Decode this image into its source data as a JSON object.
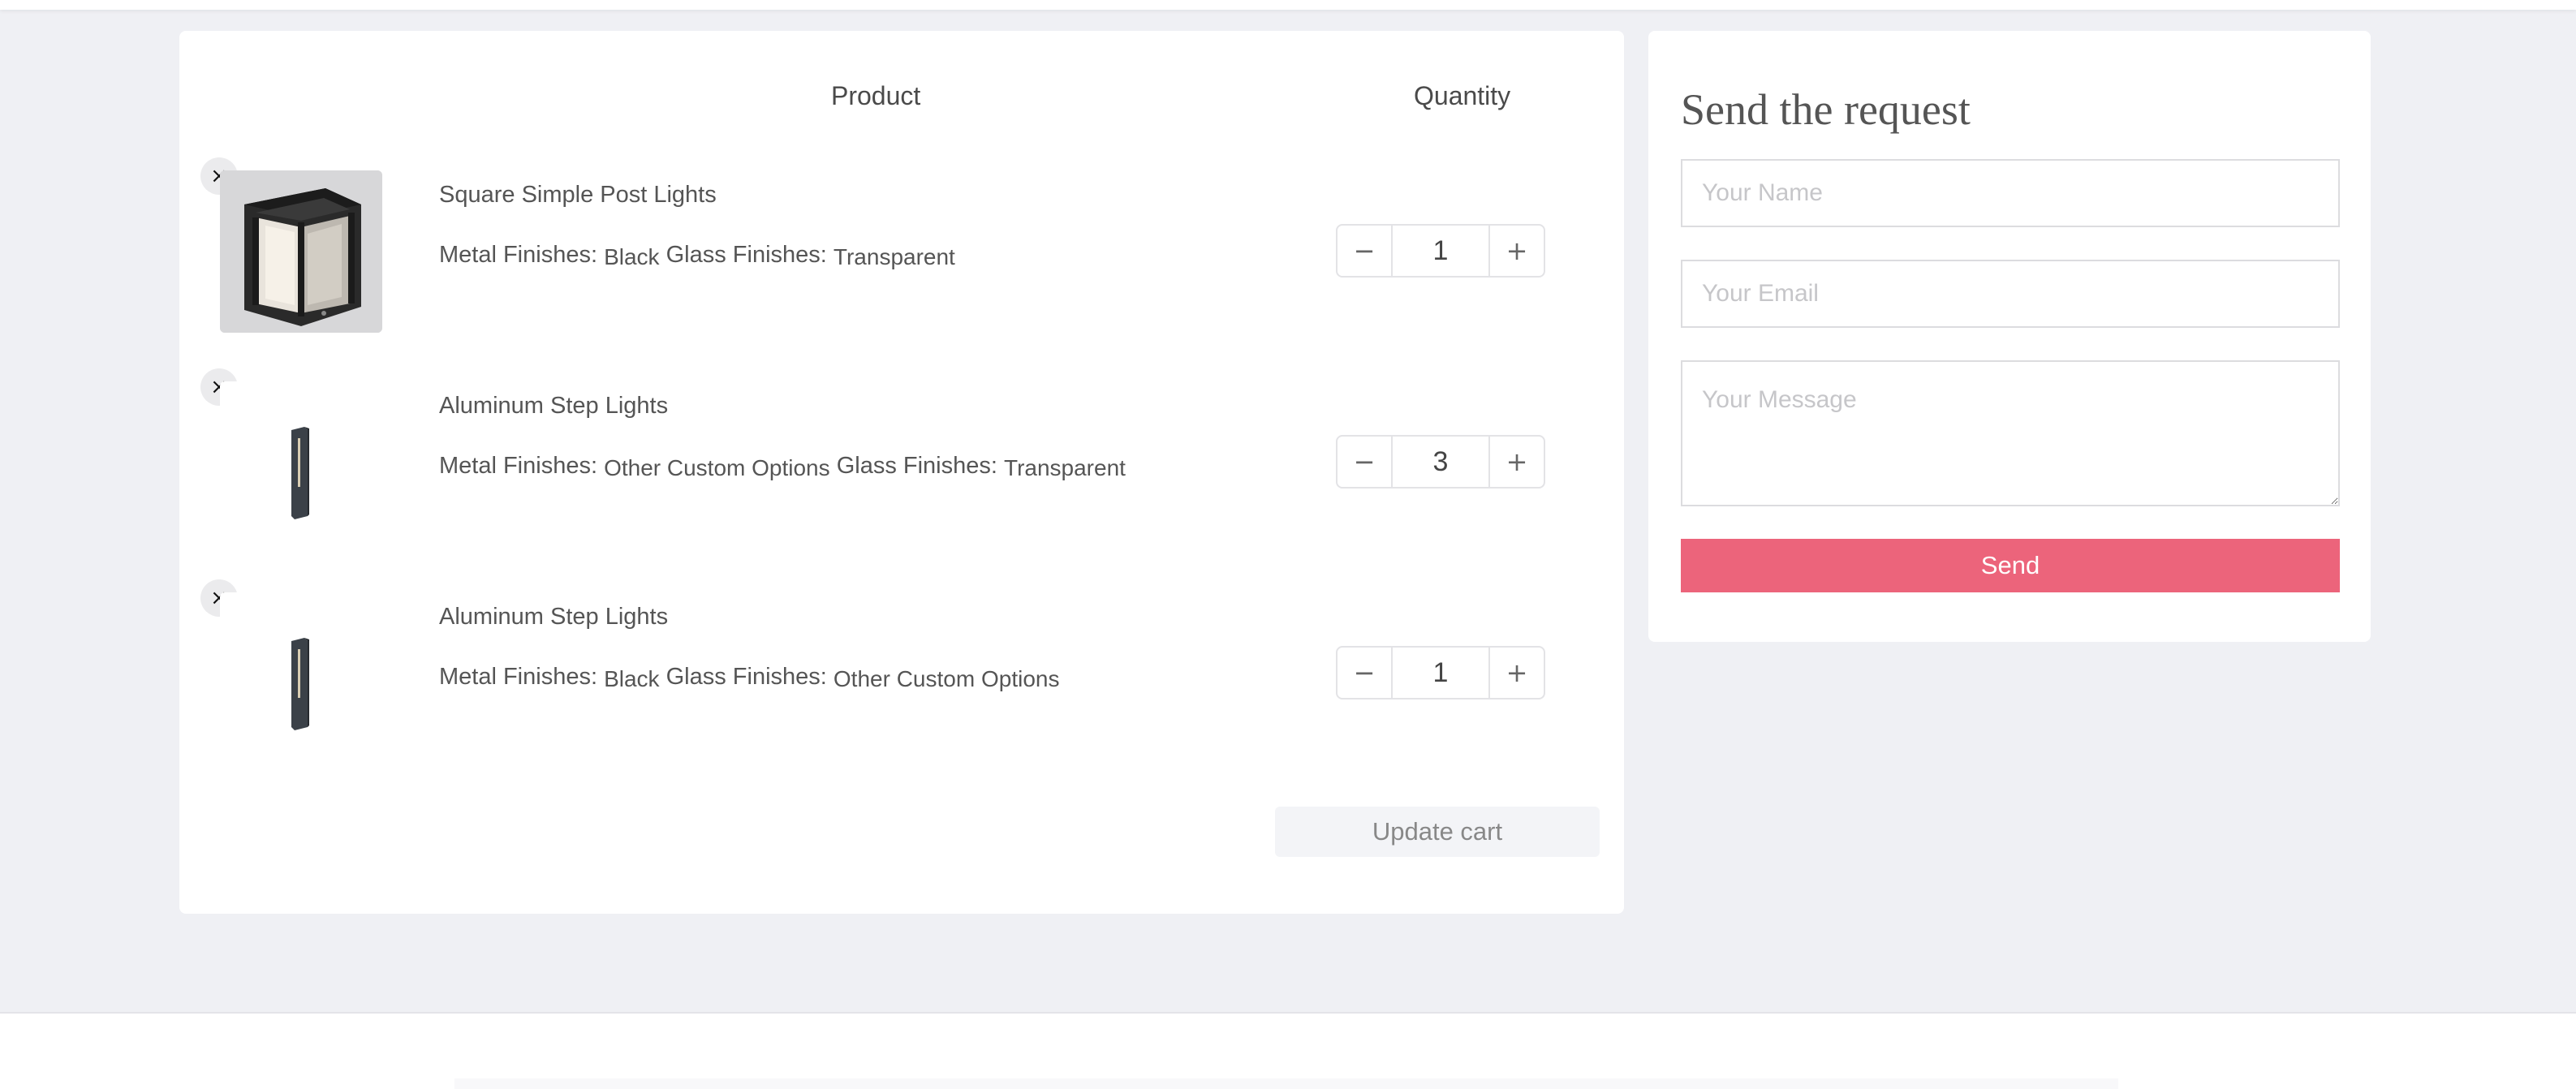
{
  "cart": {
    "headers": {
      "product": "Product",
      "quantity": "Quantity"
    },
    "remove_label": "×",
    "decrement_label": "−",
    "increment_label": "+",
    "items": [
      {
        "title": "Square Simple Post Lights",
        "attrs": [
          {
            "key": "Metal Finishes:",
            "value": "Black"
          },
          {
            "key": "Glass Finishes:",
            "value": "Transparent"
          }
        ],
        "quantity": "1",
        "image_icon": "square-post-light-icon"
      },
      {
        "title": "Aluminum Step Lights",
        "attrs": [
          {
            "key": "Metal Finishes:",
            "value": "Other Custom Options"
          },
          {
            "key": "Glass Finishes:",
            "value": "Transparent"
          }
        ],
        "quantity": "3",
        "image_icon": "step-light-icon"
      },
      {
        "title": "Aluminum Step Lights",
        "attrs": [
          {
            "key": "Metal Finishes:",
            "value": "Black"
          },
          {
            "key": "Glass Finishes:",
            "value": "Other Custom Options"
          }
        ],
        "quantity": "1",
        "image_icon": "step-light-icon"
      }
    ],
    "update_label": "Update cart"
  },
  "request": {
    "title": "Send the request",
    "name_placeholder": "Your Name",
    "email_placeholder": "Your Email",
    "message_placeholder": "Your Message",
    "send_label": "Send"
  },
  "colors": {
    "page_bg": "#eff0f4",
    "accent": "#ec647b",
    "panel_bg": "#ffffff"
  }
}
